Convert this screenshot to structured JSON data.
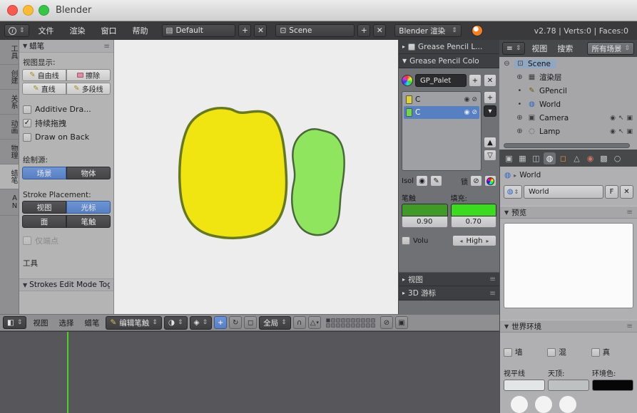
{
  "window": {
    "title": "Blender"
  },
  "icons": {
    "info": "i",
    "ud": "⇕",
    "dd": "▾",
    "plus": "+",
    "close": "✕",
    "grid": "▤",
    "scene": "⊡",
    "pencil": "✎",
    "check": "✓",
    "dots": "≡",
    "tri_r": "▸",
    "tri_d": "▼",
    "tri_u": "▲",
    "tri_dn": "▽",
    "left": "◂",
    "eye": "◉",
    "lock": "⊘",
    "cam": "▣",
    "cursor": "↖",
    "world": "◍",
    "expand": "⊕",
    "collapse": "⊖",
    "dot": "•",
    "layers_ic": "▦",
    "lamp": "◌",
    "rotate": "↻",
    "scale": "◻",
    "magnet": "∩",
    "snap_el": "△",
    "sphere": "◑",
    "pivot": "◈",
    "half": "◧",
    "scn": "◫",
    "tex": "▩",
    "ring": "○"
  },
  "infobar": {
    "menu_file": "文件",
    "menu_render": "渲染",
    "menu_window": "窗口",
    "menu_help": "帮助",
    "layout_value": "Default",
    "scene_value": "Scene",
    "engine_value": "Blender 渲染",
    "stats": "v2.78 | Verts:0 | Faces:0"
  },
  "tool_tabs": {
    "t0": "工具",
    "t1": "创建",
    "t2": "关系",
    "t3": "动画",
    "t4": "物理",
    "t5": "蜡笔",
    "t6": "AN"
  },
  "tool_panel": {
    "header": "蜡笔",
    "view_display": "视图显示:",
    "btn_draw": "自由线",
    "btn_erase": "擦除",
    "btn_line": "直线",
    "btn_poly": "多段线",
    "chk_additive": "Additive Dra...",
    "chk_continuous": "持续拖拽",
    "chk_back": "Draw on Back",
    "data_source": "绘制源:",
    "src_scene": "场景",
    "src_object": "物体",
    "stroke_placement": "Stroke Placement:",
    "pl_view": "视图",
    "pl_cursor": "光标",
    "pl_surface": "面",
    "pl_stroke": "笔触",
    "only_endpoints": "仅端点",
    "tools_label": "工具",
    "edit_panel": "Strokes Edit Mode Toggl"
  },
  "canvas": {
    "bg": "#ededee",
    "blob1_fill": "#f0e411",
    "blob1_stroke": "#66791f",
    "blob2_fill": "#90e55f",
    "blob2_stroke": "#49683a"
  },
  "npanel": {
    "layers_header": "Grease Pencil L...",
    "colors_header": "Grease Pencil Colo",
    "palette_name": "GP_Palet",
    "row1_name": "C",
    "row2_name": "C",
    "row1_color": "#ded32f",
    "row2_color": "#6fd84a",
    "isolate_label": "Isol",
    "lock_label": "锁",
    "stroke_label": "笔触",
    "fill_label": "填充:",
    "stroke_alpha": "0.90",
    "fill_alpha": "0.70",
    "stroke_color": "#3f9a28",
    "fill_color": "#3bdb1d",
    "volumetric_label": "Volu",
    "quality_value": "High",
    "view_header": "视图",
    "cursor_header": "3D 游标"
  },
  "outliner": {
    "menu_view": "视图",
    "menu_search": "搜索",
    "filter_value": "所有场景",
    "row_scene": "Scene",
    "row_layers": "渲染层",
    "row_gpencil": "GPencil",
    "row_world": "World",
    "row_camera": "Camera",
    "row_lamp": "Lamp"
  },
  "props": {
    "breadcrumb": "World",
    "id_name": "World",
    "fake_user": "F",
    "preview_header": "预览",
    "world_header": "世界环境",
    "chk_paper": "墙",
    "chk_blend": "混",
    "chk_real": "真",
    "horizon_label": "视平线",
    "zenith_label": "天顶:",
    "ambient_label": "环境色:",
    "horizon_color": "#e4e5e7",
    "zenith_color": "#bfc0c2",
    "ambient_color": "#060606"
  },
  "view3d": {
    "menu_view": "视图",
    "menu_select": "选择",
    "menu_gp": "蜡笔",
    "mode_value": "编辑笔触",
    "orientation_value": "全局"
  },
  "timeline": {
    "playhead_color": "#4ad41f"
  }
}
